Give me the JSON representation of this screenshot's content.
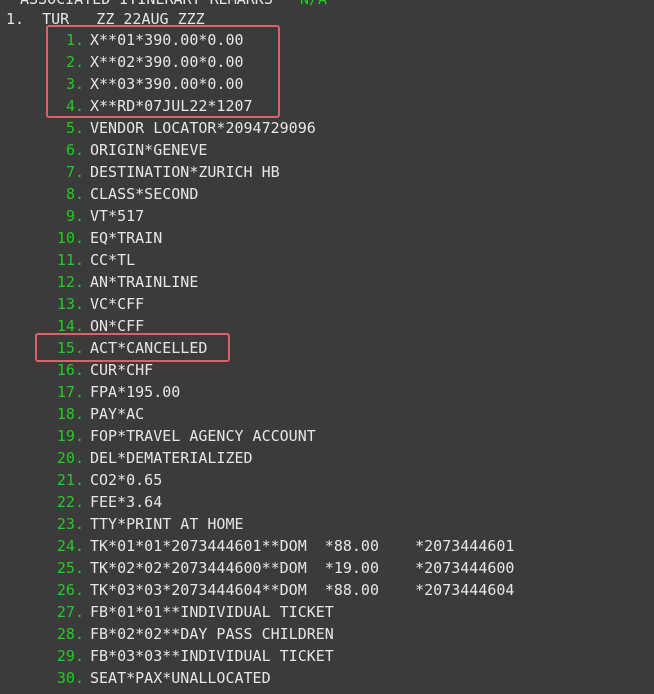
{
  "screen": {
    "top_line_prefix": "ASSOCIATED ITINERARY REMARKS   ",
    "top_line_status": "N/A",
    "header_line": "1.  TUR   ZZ 22AUG ZZZ"
  },
  "colors": {
    "background": "#3b3b3b",
    "text": "#e6e6e6",
    "line_number": "#22cc22",
    "highlight_box": "#e0606a"
  },
  "lines": [
    {
      "num": "1.",
      "text": "X**01*390.00*0.00"
    },
    {
      "num": "2.",
      "text": "X**02*390.00*0.00"
    },
    {
      "num": "3.",
      "text": "X**03*390.00*0.00"
    },
    {
      "num": "4.",
      "text": "X**RD*07JUL22*1207"
    },
    {
      "num": "5.",
      "text": "VENDOR LOCATOR*2094729096"
    },
    {
      "num": "6.",
      "text": "ORIGIN*GENEVE"
    },
    {
      "num": "7.",
      "text": "DESTINATION*ZURICH HB"
    },
    {
      "num": "8.",
      "text": "CLASS*SECOND"
    },
    {
      "num": "9.",
      "text": "VT*517"
    },
    {
      "num": "10.",
      "text": "EQ*TRAIN"
    },
    {
      "num": "11.",
      "text": "CC*TL"
    },
    {
      "num": "12.",
      "text": "AN*TRAINLINE"
    },
    {
      "num": "13.",
      "text": "VC*CFF"
    },
    {
      "num": "14.",
      "text": "ON*CFF"
    },
    {
      "num": "15.",
      "text": "ACT*CANCELLED"
    },
    {
      "num": "16.",
      "text": "CUR*CHF"
    },
    {
      "num": "17.",
      "text": "FPA*195.00"
    },
    {
      "num": "18.",
      "text": "PAY*AC"
    },
    {
      "num": "19.",
      "text": "FOP*TRAVEL AGENCY ACCOUNT"
    },
    {
      "num": "20.",
      "text": "DEL*DEMATERIALIZED"
    },
    {
      "num": "21.",
      "text": "CO2*0.65"
    },
    {
      "num": "22.",
      "text": "FEE*3.64"
    },
    {
      "num": "23.",
      "text": "TTY*PRINT AT HOME"
    },
    {
      "num": "24.",
      "text": "TK*01*01*2073444601**DOM  *88.00    *2073444601"
    },
    {
      "num": "25.",
      "text": "TK*02*02*2073444600**DOM  *19.00    *2073444600"
    },
    {
      "num": "26.",
      "text": "TK*03*03*2073444604**DOM  *88.00    *2073444604"
    },
    {
      "num": "27.",
      "text": "FB*01*01**INDIVIDUAL TICKET"
    },
    {
      "num": "28.",
      "text": "FB*02*02**DAY PASS CHILDREN"
    },
    {
      "num": "29.",
      "text": "FB*03*03**INDIVIDUAL TICKET"
    },
    {
      "num": "30.",
      "text": "SEAT*PAX*UNALLOCATED"
    }
  ]
}
